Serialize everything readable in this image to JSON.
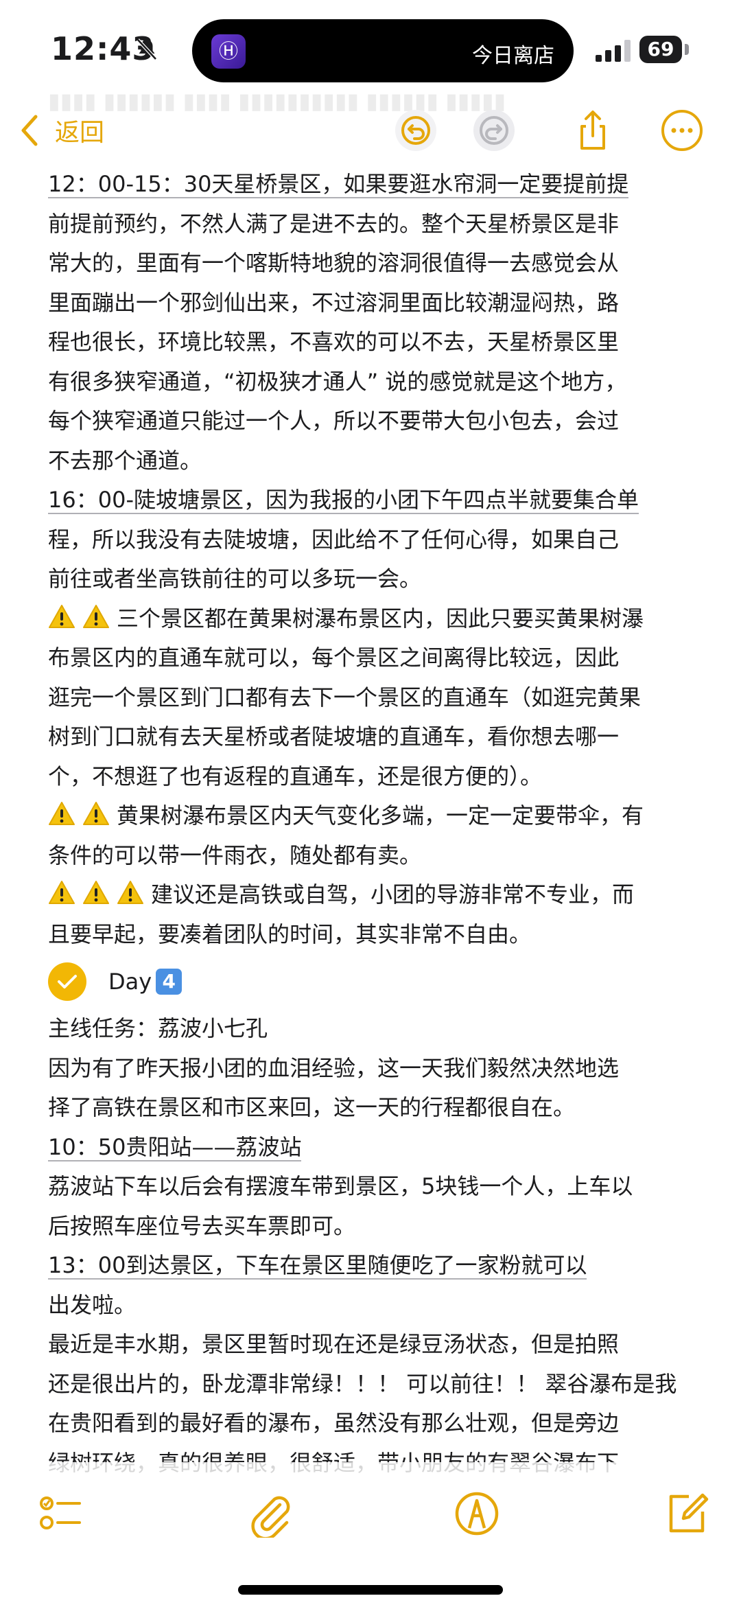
{
  "status_bar": {
    "time": "12:43",
    "live_activity_icon": "Ⓗ",
    "live_activity_text": "今日离店",
    "battery": "69"
  },
  "nav": {
    "back_label": "返回"
  },
  "colors": {
    "accent": "#e5a70b",
    "check": "#f2b705",
    "text": "#1c1c1e"
  },
  "note": {
    "lines": [
      "12：00-15：30天星桥景区，如果要逛水帘洞一定要提前提",
      "前提前预约，不然人满了是进不去的。整个天星桥景区是非",
      "常大的，里面有一个喀斯特地貌的溶洞很值得一去感觉会从",
      "里面蹦出一个邪剑仙出来，不过溶洞里面比较潮湿闷热，路",
      "程也很长，环境比较黑，不喜欢的可以不去，天星桥景区里",
      "有很多狭窄通道，“初极狭才通人” 说的感觉就是这个地方，",
      "每个狭窄通道只能过一个人，所以不要带大包小包去，会过",
      "不去那个通道。",
      "16：00-陡坡塘景区，因为我报的小团下午四点半就要集合单",
      "程，所以我没有去陡坡塘，因此给不了任何心得，如果自己",
      "前往或者坐高铁前往的可以多玩一会。",
      "三个景区都在黄果树瀑布景区内，因此只要买黄果树瀑",
      "布景区内的直通车就可以，每个景区之间离得比较远，因此",
      "逛完一个景区到门口都有去下一个景区的直通车（如逛完黄果",
      "树到门口就有去天星桥或者陡坡塘的直通车，看你想去哪一",
      "个，不想逛了也有返程的直通车，还是很方便的）。",
      "黄果树瀑布景区内天气变化多端，一定一定要带伞，有",
      "条件的可以带一件雨衣，随处都有卖。",
      "建议还是高铁或自驾，小团的导游非常不专业，而",
      "且要早起，要凑着团队的时间，其实非常不自由。"
    ],
    "day_label": "Day",
    "day_number": "4",
    "lines2": [
      "主线任务：荔波小七孔",
      "因为有了昨天报小团的血泪经验，这一天我们毅然决然地选",
      "择了高铁在景区和市区来回，这一天的行程都很自在。",
      "10：50贵阳站——荔波站",
      "荔波站下车以后会有摆渡车带到景区，5块钱一个人，上车以",
      "后按照车座位号去买车票即可。",
      "13：00到达景区，下车在景区里随便吃了一家粉就可以",
      "出发啦。",
      "最近是丰水期，景区里暂时现在还是绿豆汤状态，但是拍照",
      "还是很出片的，卧龙潭非常绿！！！ 可以前往！！ 翠谷瀑布是我",
      "在贵阳看到的最好看的瀑布，虽然没有那么壮观，但是旁边",
      "绿树环绕，真的很养眼，很舒适，带小朋友的有翠谷瀑布下"
    ]
  }
}
